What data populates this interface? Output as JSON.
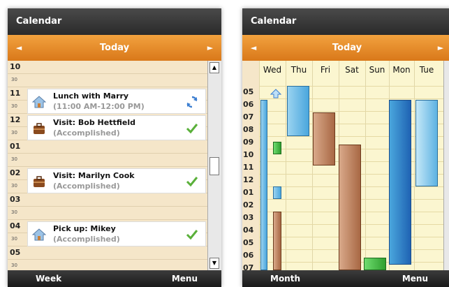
{
  "left": {
    "title": "Calendar",
    "nav": {
      "prev": "◄",
      "today": "Today",
      "next": "►"
    },
    "hours": [
      "10",
      "11",
      "12",
      "01",
      "02",
      "03",
      "04",
      "05"
    ],
    "half": "30",
    "events": [
      {
        "title": "Lunch with Marry",
        "sub": "(11:00 AM-12:00 PM)",
        "icon": "house-icon",
        "status": "sync-icon"
      },
      {
        "title": "Visit: Bob Hettfield",
        "sub": "(Accomplished)",
        "icon": "briefcase-icon",
        "status": "checkmark-icon"
      },
      {
        "title": "Visit: Marilyn Cook",
        "sub": "(Accomplished)",
        "icon": "briefcase-icon",
        "status": "checkmark-icon"
      },
      {
        "title": "Pick up: Mikey",
        "sub": "(Accomplished)",
        "icon": "house-icon",
        "status": "checkmark-icon"
      }
    ],
    "softkeys": {
      "left": "Week",
      "right": "Menu"
    }
  },
  "right": {
    "title": "Calendar",
    "nav": {
      "prev": "◄",
      "today": "Today",
      "next": "►"
    },
    "days": [
      "Wed",
      "Thu",
      "Fri",
      "Sat",
      "Sun",
      "Mon",
      "Tue"
    ],
    "hours": [
      "05",
      "06",
      "07",
      "08",
      "09",
      "10",
      "11",
      "12",
      "01",
      "02",
      "03",
      "04",
      "05",
      "06",
      "07"
    ],
    "softkeys": {
      "left": "Month",
      "right": "Menu"
    }
  },
  "colors": {
    "titlebar": "#2f2f2f",
    "nav": "#e8892a",
    "list_bg": "#f5e6c9",
    "grid_bg": "#fbf6d0"
  }
}
